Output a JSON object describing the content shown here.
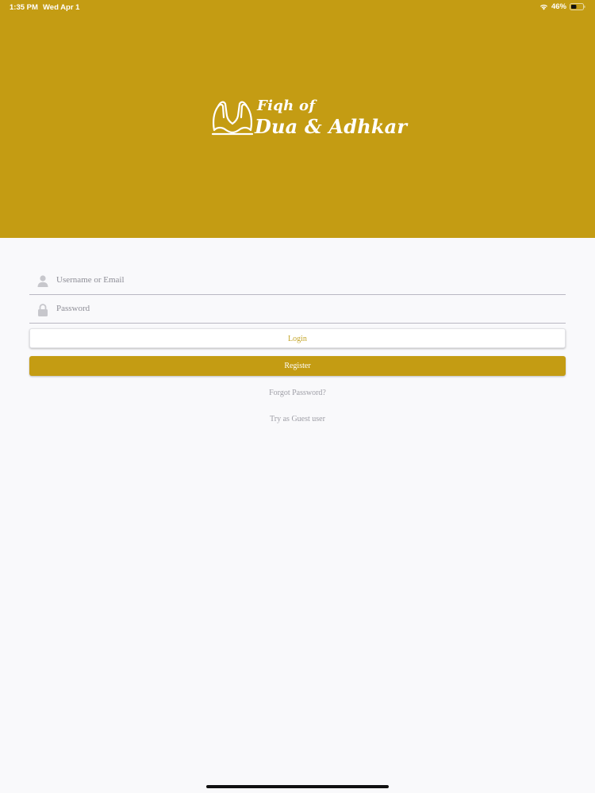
{
  "status_bar": {
    "time": "1:35 PM",
    "date": "Wed Apr 1",
    "battery": "46%",
    "battery_level": 0.46
  },
  "logo": {
    "line1": "Fiqh of",
    "line2": "Dua & Adhkar",
    "icon": "praying-hands-icon"
  },
  "form": {
    "username_placeholder": "Username or Email",
    "password_placeholder": "Password",
    "username_icon": "user-icon",
    "password_icon": "lock-icon",
    "login_label": "Login",
    "register_label": "Register",
    "forgot_label": "Forgot Password?",
    "guest_label": "Try as Guest user"
  },
  "colors": {
    "brand": "#c49c13",
    "background": "#f9f9fb",
    "login_text": "#c4a62a",
    "link_text": "#9e9ea6"
  }
}
